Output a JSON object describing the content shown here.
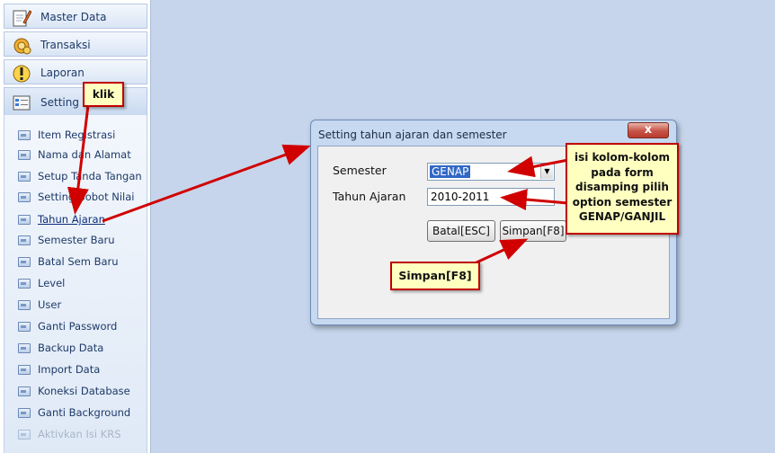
{
  "sidebar": {
    "groups": [
      {
        "label": "Master Data",
        "icon": "notepad-pencil-icon"
      },
      {
        "label": "Transaksi",
        "icon": "gear-coins-icon"
      },
      {
        "label": "Laporan",
        "icon": "exclamation-icon"
      },
      {
        "label": "Setting",
        "icon": "settings-list-icon"
      }
    ],
    "setting_items": [
      {
        "label": "Item Registrasi"
      },
      {
        "label": "Nama dan Alamat"
      },
      {
        "label": "Setup Tanda Tangan"
      },
      {
        "label": "Setting Bobot Nilai"
      },
      {
        "label": "Tahun Ajaran"
      },
      {
        "label": "Semester Baru"
      },
      {
        "label": "Batal Sem Baru"
      },
      {
        "label": "Level"
      },
      {
        "label": "User"
      },
      {
        "label": "Ganti Password"
      },
      {
        "label": "Backup Data"
      },
      {
        "label": "Import Data"
      },
      {
        "label": "Koneksi Database"
      },
      {
        "label": "Ganti Background"
      },
      {
        "label": "Aktivkan Isi KRS"
      }
    ]
  },
  "dialog": {
    "title": "Setting tahun ajaran dan semester",
    "close_label": "x",
    "semester_label": "Semester",
    "semester_value": "GENAP",
    "tahun_label": "Tahun Ajaran",
    "tahun_value": "2010-2011",
    "batal_label": "Batal[ESC]",
    "simpan_label": "Simpan[F8]"
  },
  "annotations": {
    "klik": "klik",
    "isi_lines": [
      "isi kolom-kolom",
      "pada form",
      "disamping pilih",
      "option semester",
      "GENAP/GANJIL"
    ],
    "simpan": "Simpan[F8]"
  },
  "colors": {
    "annotation_border": "#c00000",
    "annotation_fill": "#ffffc0",
    "selection": "#3168c6"
  }
}
